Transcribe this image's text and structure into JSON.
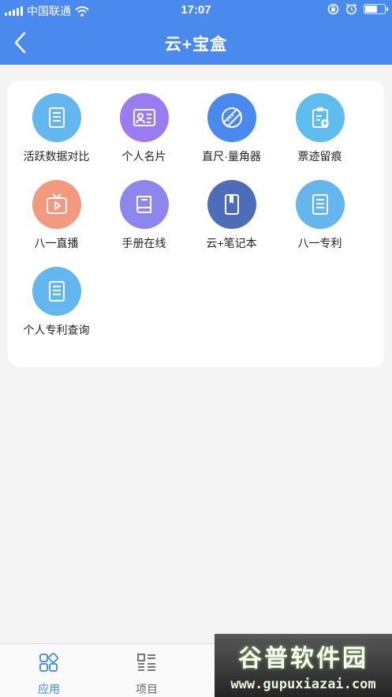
{
  "status_bar": {
    "carrier": "中国联通",
    "time": "17:07",
    "battery_level": 0.7
  },
  "nav": {
    "title": "云+宝盒",
    "back_icon": "chevron-left-icon"
  },
  "colors": {
    "primary": "#4a89ee",
    "tab_active": "#3f86ea",
    "tab_inactive": "#666666"
  },
  "apps": [
    {
      "label": "活跃数据对比",
      "icon": "document-icon",
      "color": "#64b6ee"
    },
    {
      "label": "个人名片",
      "icon": "id-card-icon",
      "color": "#9b7cf0"
    },
    {
      "label": "直尺·量角器",
      "icon": "ruler-icon",
      "color": "#4a89ee"
    },
    {
      "label": "票迹留痕",
      "icon": "clipboard-icon",
      "color": "#5fbcee"
    },
    {
      "label": "八一直播",
      "icon": "tv-play-icon",
      "color": "#f39a7e"
    },
    {
      "label": "手册在线",
      "icon": "book-icon",
      "color": "#8c86ee"
    },
    {
      "label": "云+笔记本",
      "icon": "notebook-icon",
      "color": "#4f6cb8"
    },
    {
      "label": "八一专利",
      "icon": "document-icon",
      "color": "#66b6ee"
    },
    {
      "label": "个人专利查询",
      "icon": "document-icon",
      "color": "#64b6ee"
    }
  ],
  "tabs": [
    {
      "label": "应用",
      "icon": "apps-grid-icon",
      "active": true
    },
    {
      "label": "项目",
      "icon": "project-icon",
      "active": false
    }
  ],
  "watermark": {
    "title": "谷普软件园",
    "url": "www.gupuxiazai.com"
  }
}
